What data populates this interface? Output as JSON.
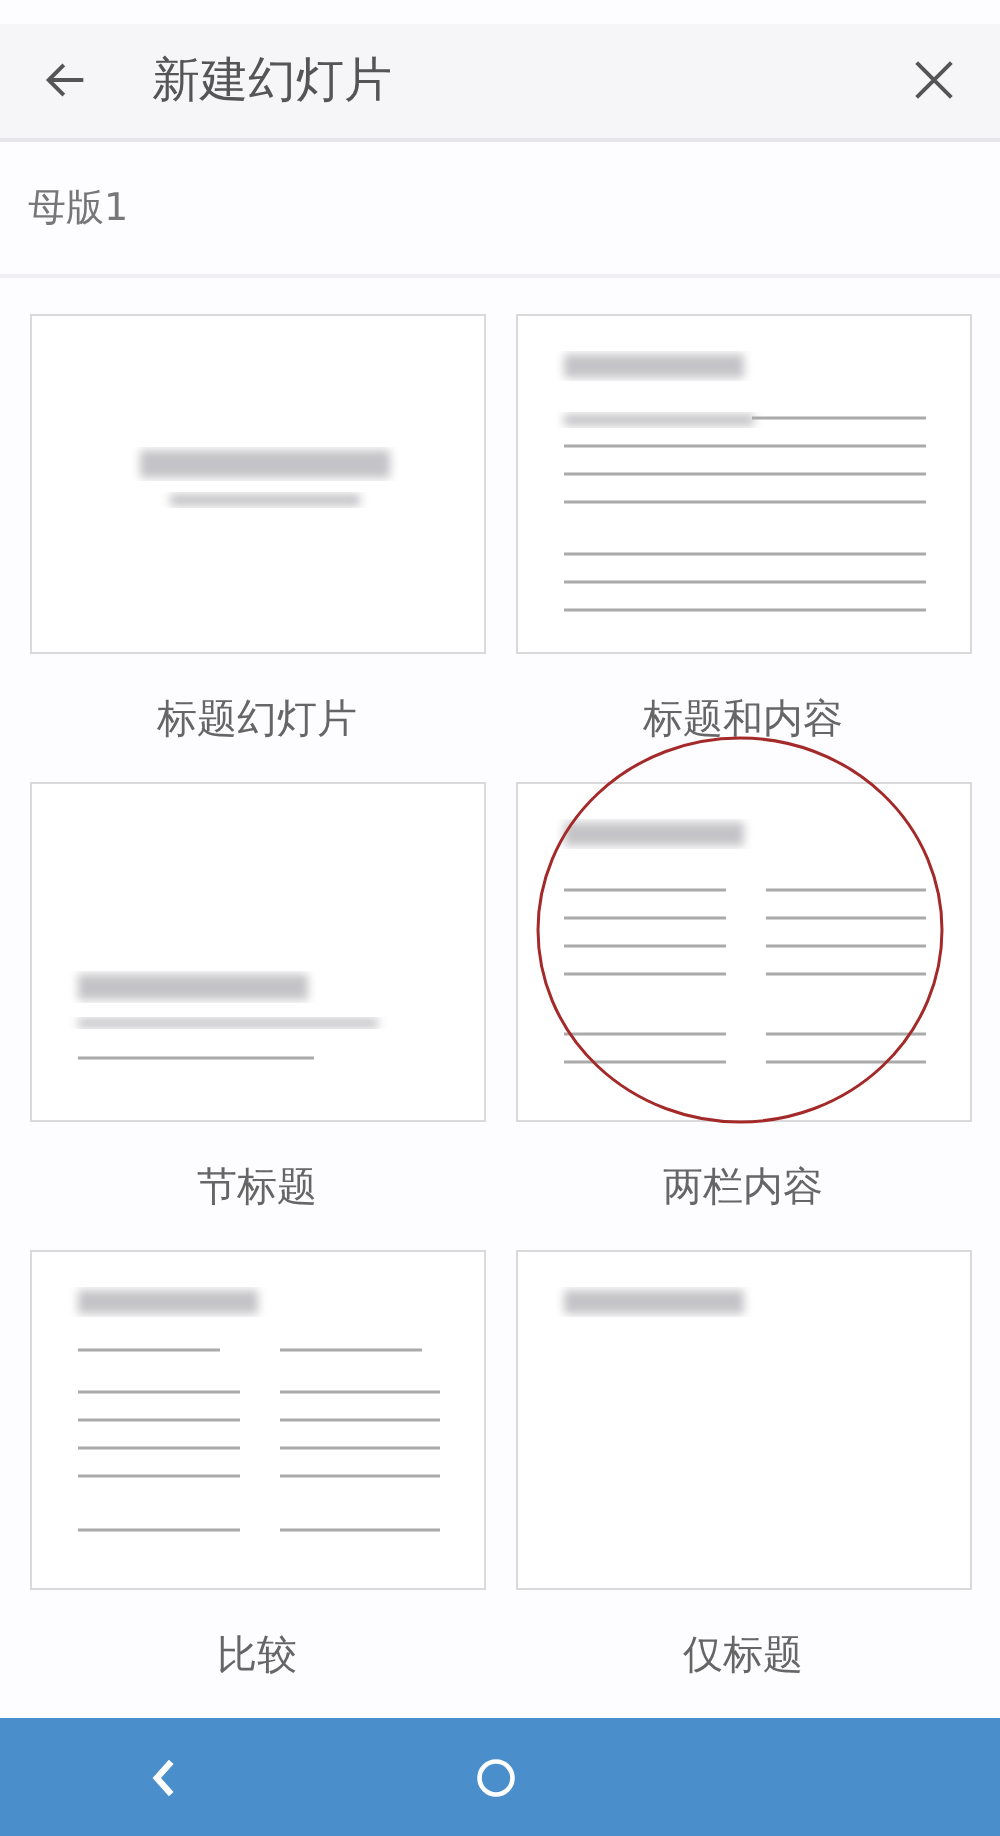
{
  "header": {
    "title": "新建幻灯片"
  },
  "section": {
    "title": "母版1"
  },
  "layouts": [
    {
      "label": "标题幻灯片",
      "kind": "title",
      "circled": false
    },
    {
      "label": "标题和内容",
      "kind": "title-content",
      "circled": false
    },
    {
      "label": "节标题",
      "kind": "section",
      "circled": false
    },
    {
      "label": "两栏内容",
      "kind": "two-column",
      "circled": true
    },
    {
      "label": "比较",
      "kind": "comparison",
      "circled": false
    },
    {
      "label": "仅标题",
      "kind": "title-only",
      "circled": false
    }
  ]
}
